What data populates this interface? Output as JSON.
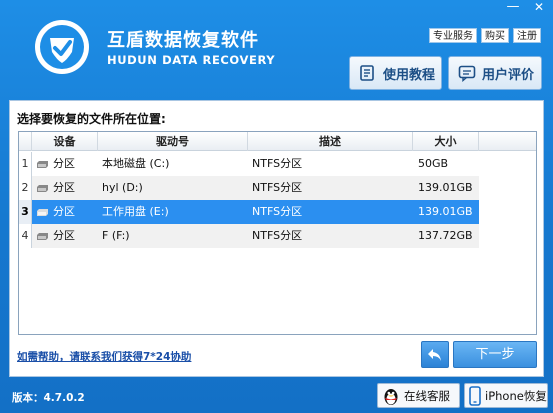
{
  "window": {
    "minimize_glyph": "—",
    "close_glyph": "✕"
  },
  "header": {
    "logo_icon": "shield-check-logo",
    "title": "互盾数据恢复软件",
    "subtitle": "HUDUN DATA RECOVERY",
    "links": [
      "专业服务",
      "购买",
      "注册"
    ],
    "buttons": [
      {
        "label": "使用教程",
        "icon": "book-icon"
      },
      {
        "label": "用户评价",
        "icon": "chat-icon"
      }
    ]
  },
  "panel": {
    "title": "选择要恢复的文件所在位置:",
    "columns": [
      "",
      "设备",
      "驱动号",
      "描述",
      "大小",
      ""
    ],
    "rows": [
      {
        "num": "1",
        "device": "分区",
        "drive": "本地磁盘 (C:)",
        "desc": "NTFS分区",
        "size": "50GB"
      },
      {
        "num": "2",
        "device": "分区",
        "drive": "hyl (D:)",
        "desc": "NTFS分区",
        "size": "139.01GB"
      },
      {
        "num": "3",
        "device": "分区",
        "drive": "工作用盘 (E:)",
        "desc": "NTFS分区",
        "size": "139.01GB"
      },
      {
        "num": "4",
        "device": "分区",
        "drive": "F (F:)",
        "desc": "NTFS分区",
        "size": "137.72GB"
      }
    ],
    "selected_row": 3,
    "help_text": "如需帮助，请联系我们获得7*24协助",
    "back_icon": "back-arrow-icon",
    "next_label": "下一步"
  },
  "footer": {
    "version": "版本：4.7.0.2",
    "buttons": [
      {
        "label": "在线客服",
        "icon": "qq-penguin-icon"
      },
      {
        "label": "iPhone恢复",
        "icon": "iphone-icon"
      }
    ]
  },
  "colors": {
    "window_blue": "#1678cf",
    "selected_row": "#2b8ff0",
    "next_button": "#3a90df"
  }
}
